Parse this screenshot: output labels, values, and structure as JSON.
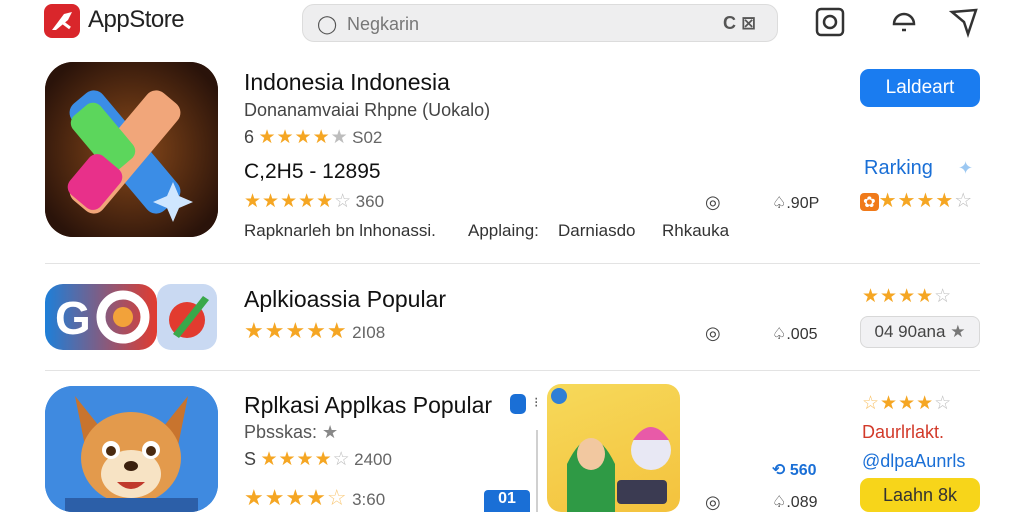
{
  "header": {
    "logo_text": "AppStore",
    "search_placeholder": "Negkarin",
    "search_right": "C ⊠"
  },
  "apps": [
    {
      "title": "Indonesia Indonesia",
      "subtitle": "Donanamvaiai Rhpne (Uokalo)",
      "rating1_prefix": "6",
      "rating1_count": "S02",
      "price_range": "C,2H5 - 12895",
      "rating2_count": "360",
      "tags": [
        "Rapknarleh bn lnhonassi.",
        "Applaing:",
        "Darniasdo",
        "Rhkauka"
      ],
      "meta_count": ".90P",
      "button": "Laldeart",
      "ranking_label": "Rarking"
    },
    {
      "title": "Aplkioassia Popular",
      "rating_count": "2I08",
      "meta_count": ".005",
      "pill_label": "04 90ana"
    },
    {
      "title": "Rplkasi Applkas Popular",
      "subtitle": "Pbsskas:",
      "rating1_prefix": "S",
      "rating1_count": "2400",
      "rating2_count": "3:60",
      "meta_count": ".089",
      "meta_blue": "560",
      "red_label": "Daurlrlakt.",
      "blue_label": "@dlpaAunrls",
      "button": "Laahn 8k",
      "badge": "01"
    }
  ],
  "colors": {
    "accent": "#1a7cf0",
    "star": "#f5a623",
    "brand_red": "#d9262b",
    "yellow": "#f7d51a"
  }
}
